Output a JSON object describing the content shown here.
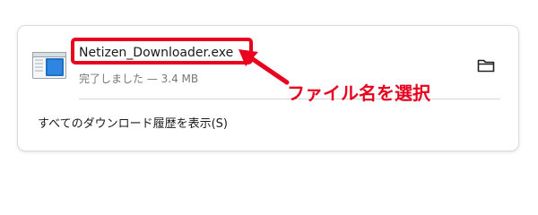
{
  "download": {
    "file_icon": "application-window-icon",
    "file_name": "Netizen_Downloader.exe",
    "status_text": "完了しました — 3.4 MB",
    "folder_icon": "folder-icon"
  },
  "footer": {
    "history_link_label": "すべてのダウンロード履歴を表示(S)"
  },
  "annotation": {
    "text": "ファイル名を選択",
    "color": "#e8001e"
  }
}
